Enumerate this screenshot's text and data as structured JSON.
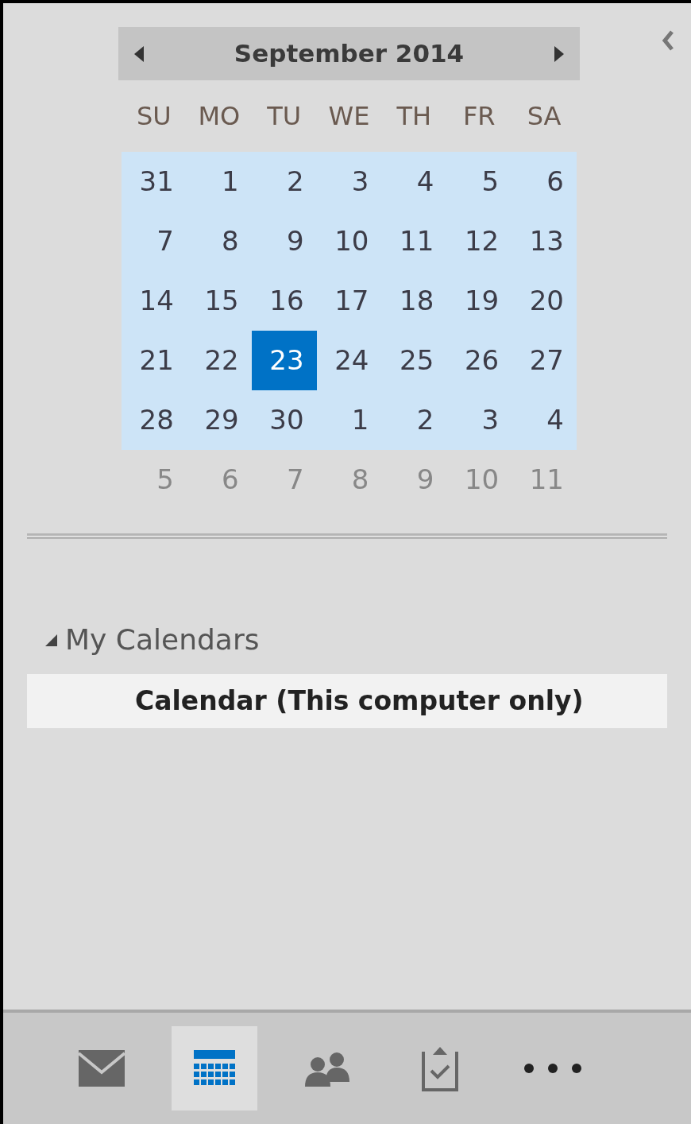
{
  "date_navigator": {
    "month_title": "September 2014",
    "weekdays": [
      "SU",
      "MO",
      "TU",
      "WE",
      "TH",
      "FR",
      "SA"
    ],
    "weeks": [
      {
        "highlighted": true,
        "days": [
          {
            "label": "31",
            "selected": false
          },
          {
            "label": "1",
            "selected": false
          },
          {
            "label": "2",
            "selected": false
          },
          {
            "label": "3",
            "selected": false
          },
          {
            "label": "4",
            "selected": false
          },
          {
            "label": "5",
            "selected": false
          },
          {
            "label": "6",
            "selected": false
          }
        ]
      },
      {
        "highlighted": true,
        "days": [
          {
            "label": "7",
            "selected": false
          },
          {
            "label": "8",
            "selected": false
          },
          {
            "label": "9",
            "selected": false
          },
          {
            "label": "10",
            "selected": false
          },
          {
            "label": "11",
            "selected": false
          },
          {
            "label": "12",
            "selected": false
          },
          {
            "label": "13",
            "selected": false
          }
        ]
      },
      {
        "highlighted": true,
        "days": [
          {
            "label": "14",
            "selected": false
          },
          {
            "label": "15",
            "selected": false
          },
          {
            "label": "16",
            "selected": false
          },
          {
            "label": "17",
            "selected": false
          },
          {
            "label": "18",
            "selected": false
          },
          {
            "label": "19",
            "selected": false
          },
          {
            "label": "20",
            "selected": false
          }
        ]
      },
      {
        "highlighted": true,
        "days": [
          {
            "label": "21",
            "selected": false
          },
          {
            "label": "22",
            "selected": false
          },
          {
            "label": "23",
            "selected": true
          },
          {
            "label": "24",
            "selected": false
          },
          {
            "label": "25",
            "selected": false
          },
          {
            "label": "26",
            "selected": false
          },
          {
            "label": "27",
            "selected": false
          }
        ]
      },
      {
        "highlighted": true,
        "days": [
          {
            "label": "28",
            "selected": false
          },
          {
            "label": "29",
            "selected": false
          },
          {
            "label": "30",
            "selected": false
          },
          {
            "label": "1",
            "selected": false
          },
          {
            "label": "2",
            "selected": false
          },
          {
            "label": "3",
            "selected": false
          },
          {
            "label": "4",
            "selected": false
          }
        ]
      },
      {
        "highlighted": false,
        "days": [
          {
            "label": "5",
            "selected": false
          },
          {
            "label": "6",
            "selected": false
          },
          {
            "label": "7",
            "selected": false
          },
          {
            "label": "8",
            "selected": false
          },
          {
            "label": "9",
            "selected": false
          },
          {
            "label": "10",
            "selected": false
          },
          {
            "label": "11",
            "selected": false
          }
        ]
      }
    ]
  },
  "folder_group": {
    "title": "My Calendars",
    "expanded": true,
    "items": [
      {
        "label": "Calendar (This computer only)",
        "selected": true
      }
    ]
  },
  "navigation_bar": [
    {
      "kind": "mail",
      "selected": false
    },
    {
      "kind": "calendar",
      "selected": true
    },
    {
      "kind": "people",
      "selected": false
    },
    {
      "kind": "tasks",
      "selected": false
    },
    {
      "kind": "more",
      "selected": false
    }
  ]
}
